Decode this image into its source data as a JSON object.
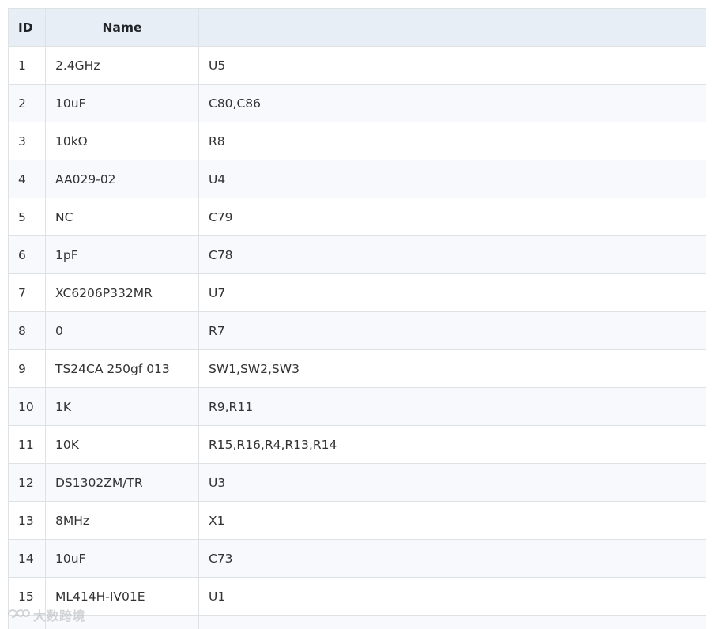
{
  "table": {
    "headers": {
      "id": "ID",
      "name": "Name",
      "designator": ""
    },
    "rows": [
      {
        "id": "1",
        "name": "2.4GHz",
        "designator": "U5"
      },
      {
        "id": "2",
        "name": "10uF",
        "designator": "C80,C86"
      },
      {
        "id": "3",
        "name": "10kΩ",
        "designator": "R8"
      },
      {
        "id": "4",
        "name": "AA029-02",
        "designator": "U4"
      },
      {
        "id": "5",
        "name": "NC",
        "designator": "C79"
      },
      {
        "id": "6",
        "name": "1pF",
        "designator": "C78"
      },
      {
        "id": "7",
        "name": "XC6206P332MR",
        "designator": "U7"
      },
      {
        "id": "8",
        "name": "0",
        "designator": "R7"
      },
      {
        "id": "9",
        "name": "TS24CA 250gf 013",
        "designator": "SW1,SW2,SW3"
      },
      {
        "id": "10",
        "name": "1K",
        "designator": "R9,R11"
      },
      {
        "id": "11",
        "name": "10K",
        "designator": "R15,R16,R4,R13,R14"
      },
      {
        "id": "12",
        "name": "DS1302ZM/TR",
        "designator": "U3"
      },
      {
        "id": "13",
        "name": "8MHz",
        "designator": "X1"
      },
      {
        "id": "14",
        "name": "10uF",
        "designator": "C73"
      },
      {
        "id": "15",
        "name": "ML414H-IV01E",
        "designator": "U1"
      },
      {
        "id": "",
        "name": "",
        "designator": ""
      }
    ]
  },
  "watermark": {
    "text": "大数跨境"
  },
  "colors": {
    "header_bg": "#e8eef5",
    "row_alt_bg": "#f7f9fc",
    "border": "#dfe2e5",
    "text": "#333333"
  }
}
